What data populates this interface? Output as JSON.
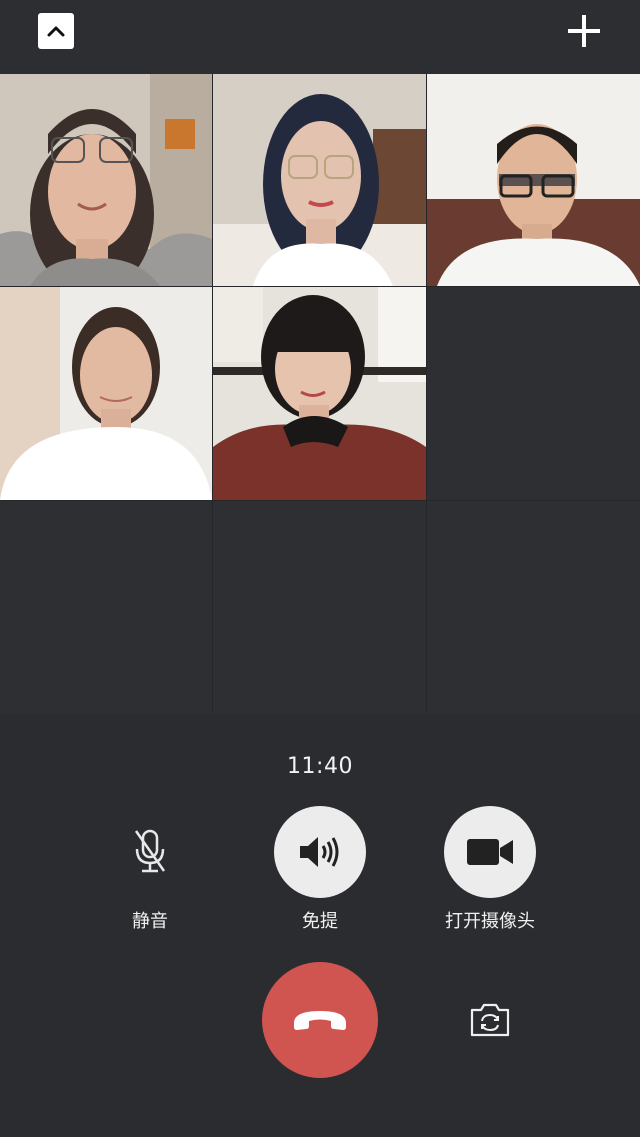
{
  "call": {
    "duration": "11:40"
  },
  "controls": {
    "mute_label": "静音",
    "speaker_label": "免提",
    "camera_label": "打开摄像头"
  },
  "icons": {
    "collapse": "chevron-up-icon",
    "add": "plus-icon",
    "mute": "microphone-off-icon",
    "speaker": "speaker-icon",
    "camera": "video-camera-icon",
    "hangup": "phone-hangup-icon",
    "flip": "camera-flip-icon"
  },
  "colors": {
    "hangup": "#d05450",
    "background": "#2b2c30"
  },
  "participants": [
    {
      "slot": 1,
      "video": true
    },
    {
      "slot": 2,
      "video": true
    },
    {
      "slot": 3,
      "video": true
    },
    {
      "slot": 4,
      "video": true
    },
    {
      "slot": 5,
      "video": true
    },
    {
      "slot": 6,
      "video": false
    },
    {
      "slot": 7,
      "video": false
    },
    {
      "slot": 8,
      "video": false
    },
    {
      "slot": 9,
      "video": false
    }
  ]
}
